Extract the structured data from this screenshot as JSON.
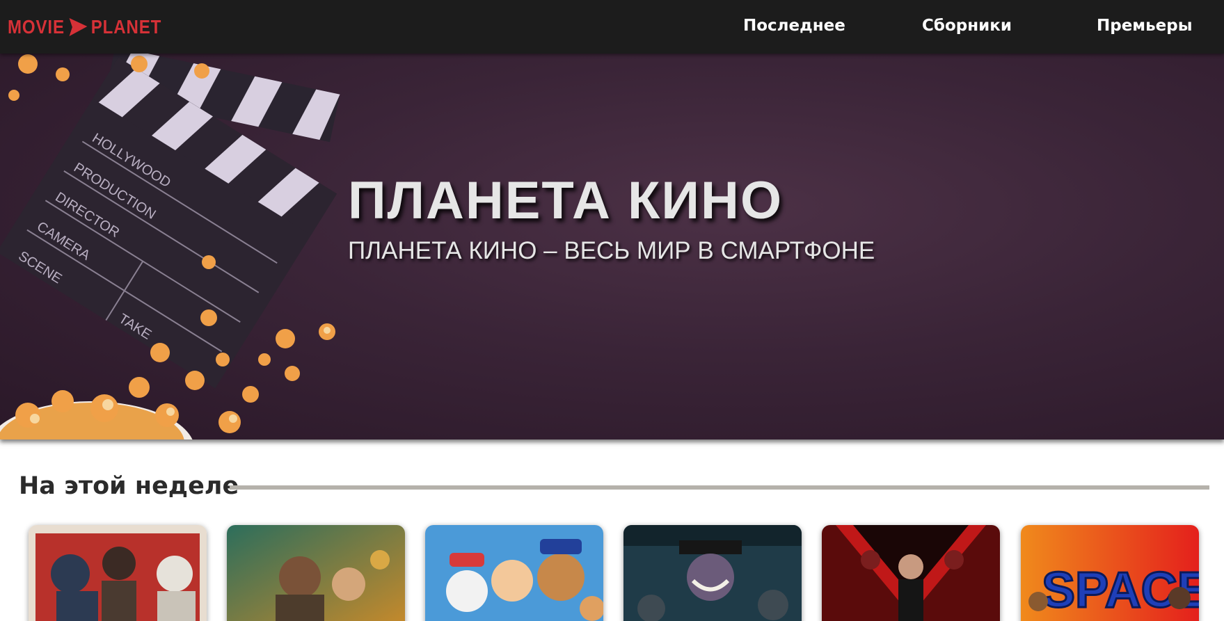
{
  "header": {
    "logo": {
      "left": "MOVIE",
      "right": "PLANET",
      "icon": "play-arrow-icon",
      "color": "#d63137"
    },
    "nav": [
      {
        "label": "Последнее"
      },
      {
        "label": "Сборники"
      },
      {
        "label": "Премьеры"
      }
    ]
  },
  "hero": {
    "title": "ПЛАНЕТА КИНО",
    "subtitle": "ПЛАНЕТА КИНО – ВЕСЬ МИР В СМАРТФОНЕ",
    "clapper_text": [
      "HOLLYWOOD",
      "PRODUCTION",
      "DIRECTOR",
      "CAMERA",
      "SCENE",
      "TAKE"
    ]
  },
  "section": {
    "title": "На этой неделе"
  },
  "posters": [
    {
      "name": "poster-1",
      "icon": "movie-poster-icon"
    },
    {
      "name": "poster-2",
      "icon": "movie-poster-icon"
    },
    {
      "name": "poster-3",
      "icon": "movie-poster-icon"
    },
    {
      "name": "poster-4",
      "icon": "movie-poster-icon"
    },
    {
      "name": "poster-5",
      "icon": "movie-poster-icon"
    },
    {
      "name": "poster-6",
      "icon": "movie-poster-icon",
      "title": "SPACE"
    }
  ],
  "colors": {
    "header_bg": "#1c1c1c",
    "hero_bg": "#3a2437",
    "accent": "#d63137",
    "divider": "#b5b2ab"
  }
}
